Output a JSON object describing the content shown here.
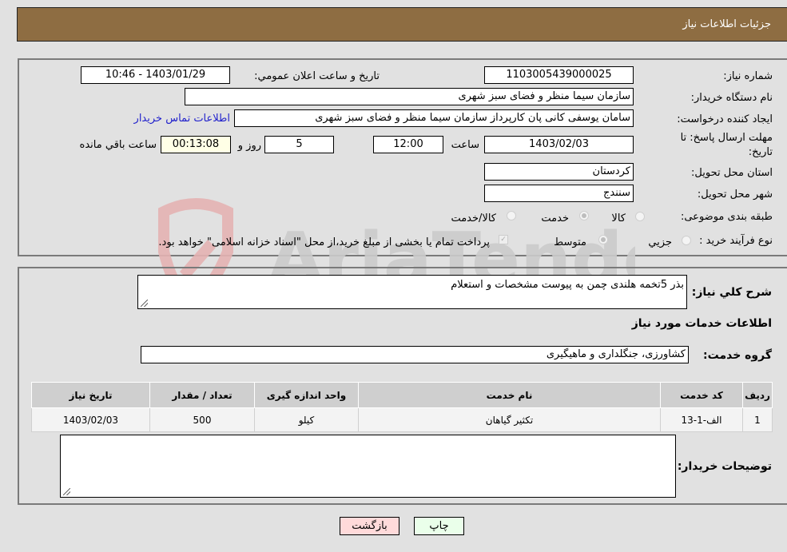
{
  "header": {
    "title": "جزئیات اطلاعات نیاز"
  },
  "form": {
    "need_number_label": "شماره نیاز:",
    "need_number": "1103005439000025",
    "announce_label": "تاریخ و ساعت اعلان عمومي:",
    "announce_value": "1403/01/29 - 10:46",
    "buyer_org_label": "نام دستگاه خریدار:",
    "buyer_org": "سازمان سیما  منظر و فضای سبز شهری",
    "creator_label": "ایجاد کننده درخواست:",
    "creator": "سامان یوسفی کانی پان کارپرداز سازمان سیما  منظر و فضای سبز شهری",
    "contact_link": "اطلاعات تماس خریدار",
    "deadline_label_1": "مهلت ارسال پاسخ: تا",
    "deadline_label_2": "تاریخ:",
    "deadline_date": "1403/02/03",
    "time_label": "ساعت",
    "deadline_time": "12:00",
    "days_value": "5",
    "days_label": "روز و",
    "remaining_time": "00:13:08",
    "remaining_label": "ساعت باقي مانده",
    "province_label": "استان محل تحویل:",
    "province": "کردستان",
    "city_label": "شهر محل تحویل:",
    "city": "سنندج",
    "category_label": "طبقه بندی موضوعی:",
    "category_options": [
      "کالا",
      "خدمت",
      "کالا/خدمت"
    ],
    "category_selected": "خدمت",
    "process_label": "نوع فرآیند خرید :",
    "process_options": [
      "جزيي",
      "متوسط"
    ],
    "process_selected": "متوسط",
    "treasury_note": "پرداخت تمام یا بخشی از مبلغ خرید،از محل \"اسناد خزانه اسلامی\" خواهد بود."
  },
  "details": {
    "description_label": "شرح كلي نياز:",
    "description": "بذر 5تخمه هلندی چمن به پیوست مشخصات و استعلام",
    "services_heading": "اطلاعات خدمات مورد نیاز",
    "service_group_label": "گروه خدمت:",
    "service_group": "کشاورزی، جنگلداری و ماهیگیری",
    "table": {
      "columns": [
        "ردیف",
        "کد خدمت",
        "نام خدمت",
        "واحد اندازه گیری",
        "تعداد / مقدار",
        "تاریخ نیاز"
      ],
      "rows": [
        [
          "1",
          "الف-1-13",
          "تکثیر گیاهان",
          "کیلو",
          "500",
          "1403/02/03"
        ]
      ]
    },
    "buyer_notes_label": "توضیحات خریدار:",
    "buyer_notes": ""
  },
  "buttons": {
    "print": "چاپ",
    "back": "بازگشت"
  },
  "colors": {
    "header_bg": "#8e6d42",
    "print_bg": "#eaffea",
    "back_bg": "#ffdada",
    "link": "#2222cc"
  }
}
